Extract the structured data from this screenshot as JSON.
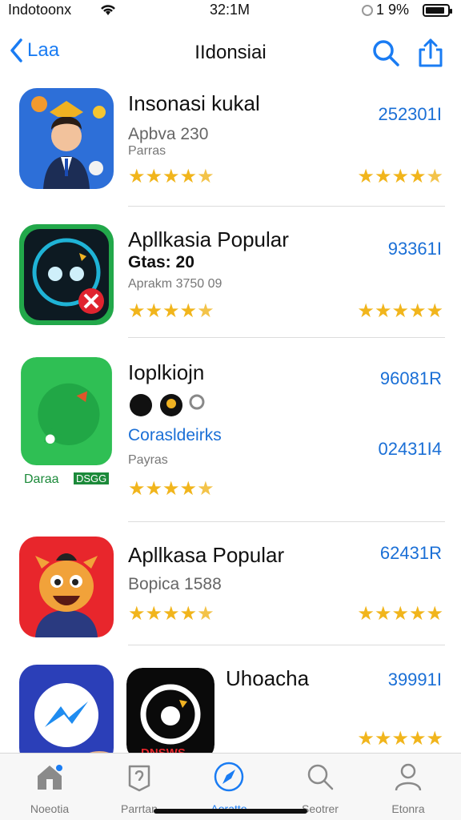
{
  "status_bar": {
    "carrier": "Indotoonx",
    "time": "32:1M",
    "battery_percent": "1 9%",
    "battery_level": 0.9
  },
  "nav": {
    "back_label": "Laa",
    "title": "IIdonsiai"
  },
  "apps": [
    {
      "title": "Insonasi kukal",
      "subtitle": "Apbva 230",
      "meta": "Parras",
      "count": "252301I",
      "rating_left": 4.5,
      "rating_right": 4.5
    },
    {
      "title": "Apllkasia Popular",
      "subtitle": "Gtas: 20",
      "meta": "Aprakm 3750 09",
      "count": "93361I",
      "rating_left": 4.5,
      "rating_right": 5
    },
    {
      "title": "Ioplkiojn",
      "link": "Corasldeirks",
      "meta": "Payras",
      "count": "96081R",
      "count2": "02431I4",
      "icon_caption_left": "Daraa",
      "icon_caption_right": "DSGG",
      "rating_left": 4.5
    },
    {
      "title": "Apllkasa Popular",
      "subtitle": "Bopica 1588",
      "count": "62431R",
      "rating_left": 4.5,
      "rating_right": 5
    },
    {
      "title": "Uhoacha",
      "count": "39991I",
      "icon_caption": "DNSWS",
      "rating_right": 5
    }
  ],
  "tabs": [
    {
      "label": "Noeotia",
      "icon": "home-icon"
    },
    {
      "label": "Parrtan",
      "icon": "games-icon"
    },
    {
      "label": "Aoratto",
      "icon": "compass-icon"
    },
    {
      "label": "Seotrer",
      "icon": "search-icon"
    },
    {
      "label": "Etonra",
      "icon": "person-icon"
    }
  ],
  "colors": {
    "accent": "#1a7cf3",
    "star": "#f1b51c",
    "count": "#1a6fd6"
  }
}
